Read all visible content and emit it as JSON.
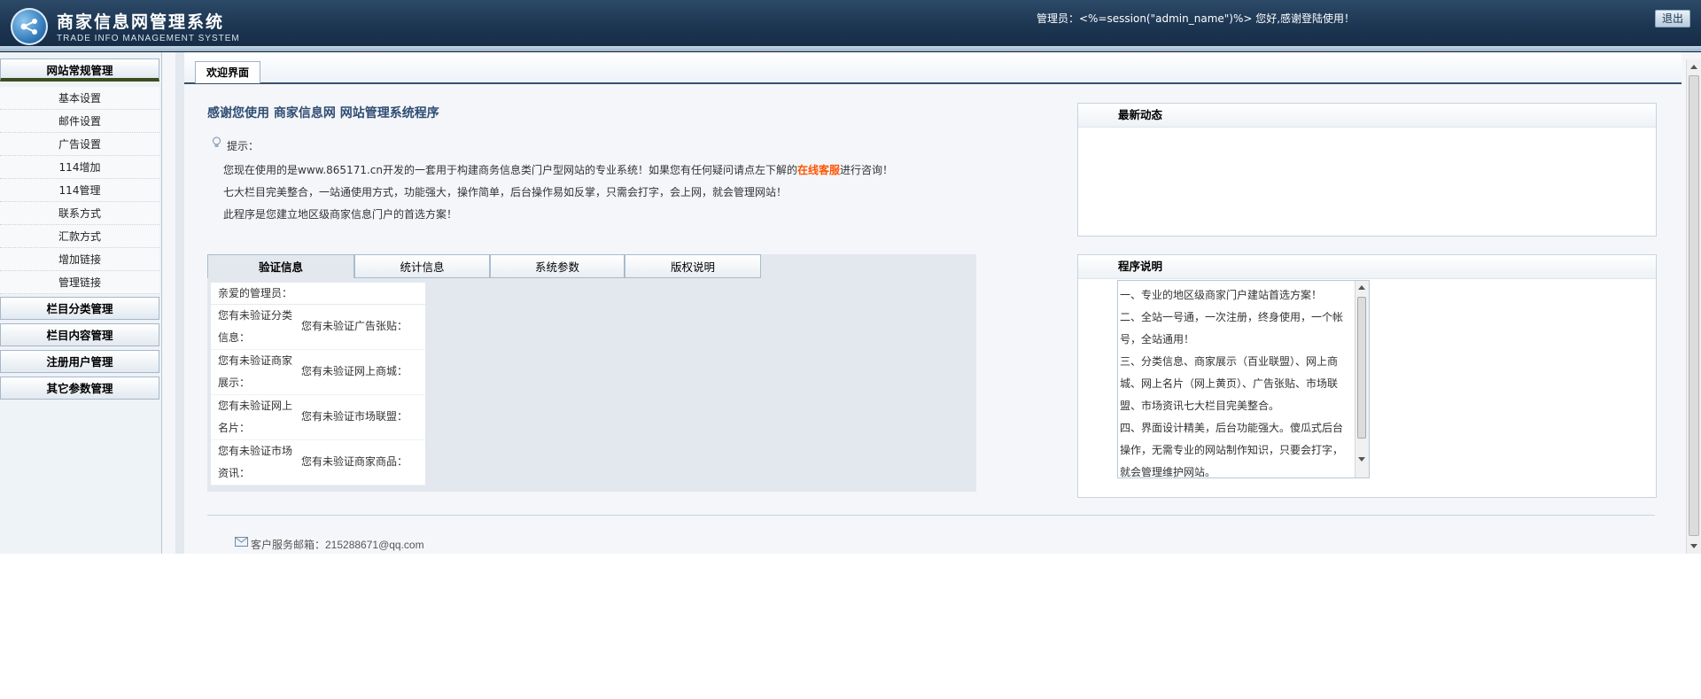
{
  "header": {
    "title": "商家信息网管理系统",
    "subtitle": "TRADE INFO MANAGEMENT SYSTEM",
    "admin_greeting": "管理员：<%=session(\"admin_name\")%> 您好,感谢登陆使用！",
    "logout_label": "退出"
  },
  "sidebar": {
    "sections": [
      {
        "label": "网站常规管理"
      },
      {
        "label": "栏目分类管理"
      },
      {
        "label": "栏目内容管理"
      },
      {
        "label": "注册用户管理"
      },
      {
        "label": "其它参数管理"
      }
    ],
    "items": [
      {
        "label": "基本设置"
      },
      {
        "label": "邮件设置"
      },
      {
        "label": "广告设置"
      },
      {
        "label": "114增加"
      },
      {
        "label": "114管理"
      },
      {
        "label": "联系方式"
      },
      {
        "label": "汇款方式"
      },
      {
        "label": "增加链接"
      },
      {
        "label": "管理链接"
      }
    ]
  },
  "main": {
    "tab_label": "欢迎界面",
    "welcome_title": "感谢您使用 商家信息网 网站管理系统程序",
    "tip_label": "提示：",
    "tip_line1_pre": "您现在使用的是www.865171.cn开发的一套用于构建商务信息类门户型网站的专业系统！如果您有任何疑问请点左下解的",
    "tip_line1_highlight": "在线客服",
    "tip_line1_post": "进行咨询！",
    "tip_line2": "七大栏目完美整合，一站通使用方式，功能强大，操作简单，后台操作易如反掌，只需会打字，会上网，就会管理网站！",
    "tip_line3": "此程序是您建立地区级商家信息门户的首选方案！",
    "news": {
      "title": "最新动态"
    },
    "desc": {
      "title": "程序说明",
      "lines": [
        "一、专业的地区级商家门户建站首选方案！",
        "二、全站一号通，一次注册，终身使用，一个帐号，全站通用！",
        "三、分类信息、商家展示（百业联盟）、网上商城、网上名片（网上黄页）、广告张贴、市场联盟、市场资讯七大栏目完美整合。",
        "四、界面设计精美，后台功能强大。傻瓜式后台操作，无需专业的网站制作知识，只要会打字，就会管理维护网站。"
      ]
    },
    "info_tabs": [
      {
        "label": "验证信息"
      },
      {
        "label": "统计信息"
      },
      {
        "label": "系统参数"
      },
      {
        "label": "版权说明"
      }
    ],
    "verify": {
      "greeting": "亲爱的管理员：",
      "rows": [
        {
          "left": "您有未验证分类信息：",
          "right": "您有未验证广告张贴："
        },
        {
          "left": "您有未验证商家展示：",
          "right": "您有未验证网上商城："
        },
        {
          "left": "您有未验证网上名片：",
          "right": "您有未验证市场联盟："
        },
        {
          "left": "您有未验证市场资讯：",
          "right": "您有未验证商家商品："
        }
      ]
    },
    "footer_email": "客户服务邮箱：215288671@qq.com"
  },
  "colors": {
    "header_bg": "#1b3450",
    "title_blue": "#2f4d73",
    "highlight_orange": "#ff5500"
  }
}
